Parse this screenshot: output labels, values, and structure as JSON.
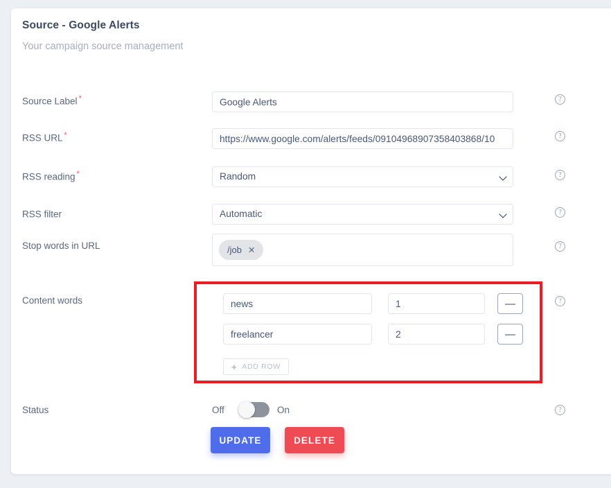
{
  "card": {
    "title": "Source - Google Alerts",
    "subtitle": "Your campaign source management"
  },
  "fields": {
    "source_label": {
      "label": "Source Label",
      "required": "*",
      "value": "Google Alerts",
      "help": "?"
    },
    "rss_url": {
      "label": "RSS URL",
      "required": "*",
      "value": "https://www.google.com/alerts/feeds/09104968907358403868/10",
      "help": "?"
    },
    "rss_reading": {
      "label": "RSS reading",
      "required": "*",
      "value": "Random",
      "help": "?"
    },
    "rss_filter": {
      "label": "RSS filter",
      "required": "",
      "value": "Automatic",
      "help": "?"
    },
    "stop_words": {
      "label": "Stop words in URL",
      "required": "",
      "help": "?",
      "chips": [
        {
          "text": "/job",
          "remove": "✕"
        }
      ]
    },
    "content_words": {
      "label": "Content words",
      "required": "",
      "help": "?",
      "add_row_label": "ADD ROW",
      "add_row_icon": "+",
      "remove_icon": "minus-icon",
      "rows": [
        {
          "word": "news",
          "weight": "1"
        },
        {
          "word": "freelancer",
          "weight": "2"
        }
      ]
    },
    "status": {
      "label": "Status",
      "off_label": "Off",
      "on_label": "On",
      "state": "off",
      "help": "?"
    }
  },
  "actions": {
    "update_label": "UPDATE",
    "delete_label": "DELETE"
  },
  "colors": {
    "highlight": "#ec1c24",
    "update": "#4f6ceb",
    "delete": "#ef4b54",
    "required": "#f2545b",
    "page_bg": "#eceff4"
  }
}
